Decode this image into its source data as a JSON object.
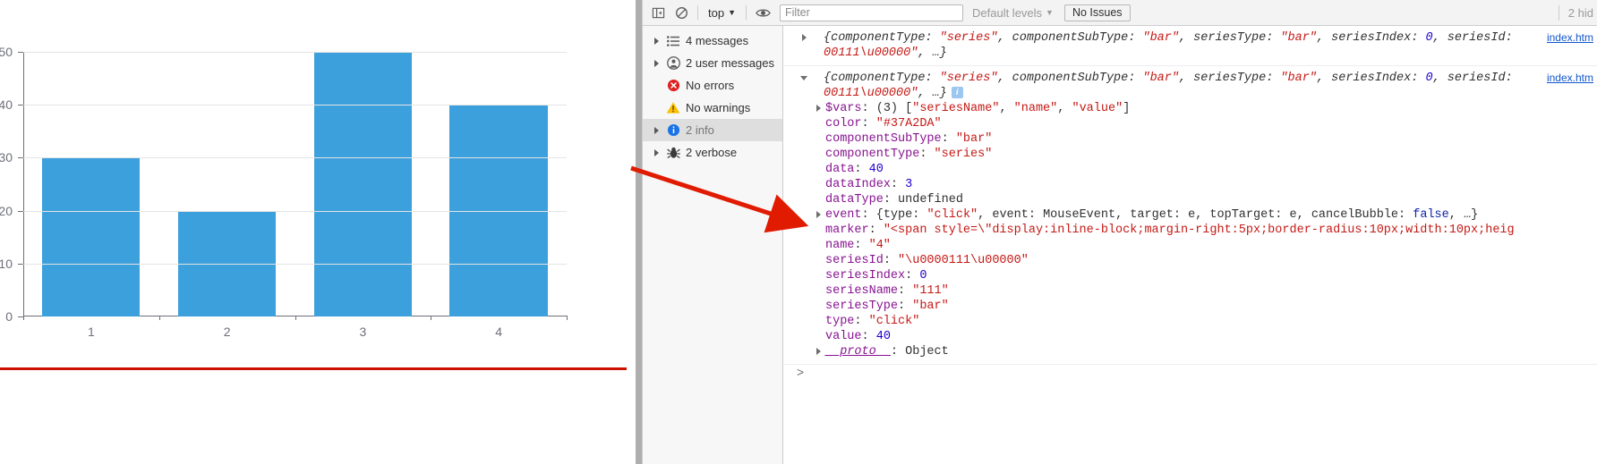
{
  "chart_data": {
    "type": "bar",
    "title": "",
    "xlabel": "",
    "ylabel": "",
    "categories": [
      "1",
      "2",
      "3",
      "4"
    ],
    "values": [
      30,
      20,
      50,
      40
    ],
    "series": [
      {
        "name": "111",
        "values": [
          30,
          20,
          50,
          40
        ]
      }
    ],
    "ylim": [
      0,
      50
    ],
    "yticks": [
      "50",
      "40",
      "30",
      "20",
      "10",
      "0"
    ],
    "bar_color": "#3ba0db",
    "grid": true,
    "legend": "none"
  },
  "annotation": {
    "arrow_color": "#e01b00",
    "underline_color": "#cc1100"
  },
  "devtools": {
    "toolbar": {
      "sidebar_toggle_icon": "show-console-sidebar-icon",
      "clear_icon": "clear-console-icon",
      "context_label": "top",
      "context_chevron": "▼",
      "eye_icon": "live-expression-eye-icon",
      "filter_placeholder": "Filter",
      "filter_value": "",
      "levels_label": "Default levels",
      "levels_chevron": "▼",
      "issues_label": "No Issues",
      "hidden_label": "2 hid"
    },
    "sidebar": [
      {
        "label": "4 messages",
        "icon": "list-icon",
        "expandable": true,
        "selected": false
      },
      {
        "label": "2 user messages",
        "icon": "person-icon",
        "expandable": true,
        "selected": false
      },
      {
        "label": "No errors",
        "icon": "error-icon",
        "expandable": false,
        "selected": false
      },
      {
        "label": "No warnings",
        "icon": "warning-icon",
        "expandable": false,
        "selected": false
      },
      {
        "label": "2 info",
        "icon": "info-icon",
        "expandable": true,
        "selected": true
      },
      {
        "label": "2 verbose",
        "icon": "bug-icon",
        "expandable": true,
        "selected": false
      }
    ],
    "log": {
      "entries": [
        {
          "collapsed": true,
          "source": "index.htm",
          "preview_line1_a": "{componentType: ",
          "preview_line1_s1": "\"series\"",
          "preview_line1_b": ", componentSubType: ",
          "preview_line1_s2": "\"bar\"",
          "preview_line1_c": ", seriesType: ",
          "preview_line1_s3": "\"bar\"",
          "preview_line1_d": ", seriesIndex: ",
          "preview_line1_n1": "0",
          "preview_line1_e": ", seriesId:",
          "preview_line2_s": "00111\\u00000\"",
          "preview_line2_t": ", …}"
        },
        {
          "collapsed": false,
          "source": "index.htm",
          "preview_line1_a": "{componentType: ",
          "preview_line1_s1": "\"series\"",
          "preview_line1_b": ", componentSubType: ",
          "preview_line1_s2": "\"bar\"",
          "preview_line1_c": ", seriesType: ",
          "preview_line1_s3": "\"bar\"",
          "preview_line1_d": ", seriesIndex: ",
          "preview_line1_n1": "0",
          "preview_line1_e": ", seriesId:",
          "preview_line2_s": "00111\\u00000\"",
          "preview_line2_t": ", …}",
          "badge": "i",
          "properties": [
            {
              "expandable": true,
              "name": "$vars",
              "value": "(3) [\"seriesName\", \"name\", \"value\"]",
              "vtype": "mixed"
            },
            {
              "expandable": false,
              "name": "color",
              "value": "\"#37A2DA\"",
              "vtype": "str"
            },
            {
              "expandable": false,
              "name": "componentSubType",
              "value": "\"bar\"",
              "vtype": "str"
            },
            {
              "expandable": false,
              "name": "componentType",
              "value": "\"series\"",
              "vtype": "str"
            },
            {
              "expandable": false,
              "name": "data",
              "value": "40",
              "vtype": "num"
            },
            {
              "expandable": false,
              "name": "dataIndex",
              "value": "3",
              "vtype": "num"
            },
            {
              "expandable": false,
              "name": "dataType",
              "value": "undefined",
              "vtype": "undef"
            },
            {
              "expandable": true,
              "name": "event",
              "value": "{type: \"click\", event: MouseEvent, target: e, topTarget: e, cancelBubble: false, …}",
              "vtype": "mixed"
            },
            {
              "expandable": false,
              "name": "marker",
              "value": "\"<span style=\\\"display:inline-block;margin-right:5px;border-radius:10px;width:10px;heig",
              "vtype": "str"
            },
            {
              "expandable": false,
              "name": "name",
              "value": "\"4\"",
              "vtype": "str"
            },
            {
              "expandable": false,
              "name": "seriesId",
              "value": "\"\\u0000111\\u00000\"",
              "vtype": "str"
            },
            {
              "expandable": false,
              "name": "seriesIndex",
              "value": "0",
              "vtype": "num"
            },
            {
              "expandable": false,
              "name": "seriesName",
              "value": "\"111\"",
              "vtype": "str"
            },
            {
              "expandable": false,
              "name": "seriesType",
              "value": "\"bar\"",
              "vtype": "str"
            },
            {
              "expandable": false,
              "name": "type",
              "value": "\"click\"",
              "vtype": "str"
            },
            {
              "expandable": false,
              "name": "value",
              "value": "40",
              "vtype": "num"
            },
            {
              "expandable": true,
              "name": "__proto__",
              "value": "Object",
              "vtype": "plain",
              "proto": true
            }
          ]
        }
      ],
      "prompt": ">"
    }
  }
}
